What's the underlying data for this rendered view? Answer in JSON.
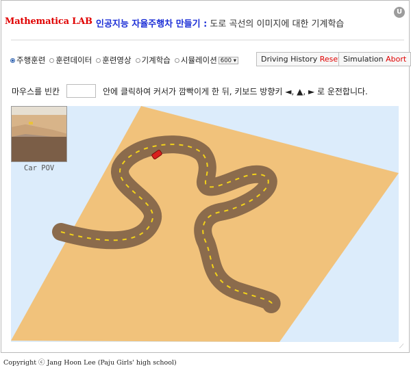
{
  "header": {
    "brand": "Mathematica LAB",
    "title_bold": "인공지능 자율주행차 만들기 :",
    "title_rest": " 도로 곡선의 이미지에 대한 기계학습",
    "user_button": "U"
  },
  "tabs": [
    {
      "label": "주행훈련",
      "selected": true
    },
    {
      "label": "훈련데이터",
      "selected": false
    },
    {
      "label": "훈련영상",
      "selected": false
    },
    {
      "label": "기계학습",
      "selected": false
    },
    {
      "label": "시뮬레이션",
      "selected": false
    }
  ],
  "speed_select": {
    "value": "600"
  },
  "buttons": {
    "driving_history": "Driving History",
    "reset": "Reset",
    "simulation": "Simulation",
    "abort": "Abort"
  },
  "instruction": {
    "before": "마우스를 빈칸",
    "after": "안에 클릭하여 커서가 깜빡이게 한 뒤, 키보드 방향키 ◄, ▲, ► 로 운전합니다."
  },
  "pov": {
    "label": "Car POV"
  },
  "colors": {
    "sky": "#dcecfb",
    "ground": "#f1c27b",
    "road": "#8b6b4c",
    "lane": "#f2d21a",
    "car": "#d8201e"
  },
  "footer": {
    "copyright": "Copyright ⓒ Jang Hoon Lee (Paju Girls' high school)"
  }
}
